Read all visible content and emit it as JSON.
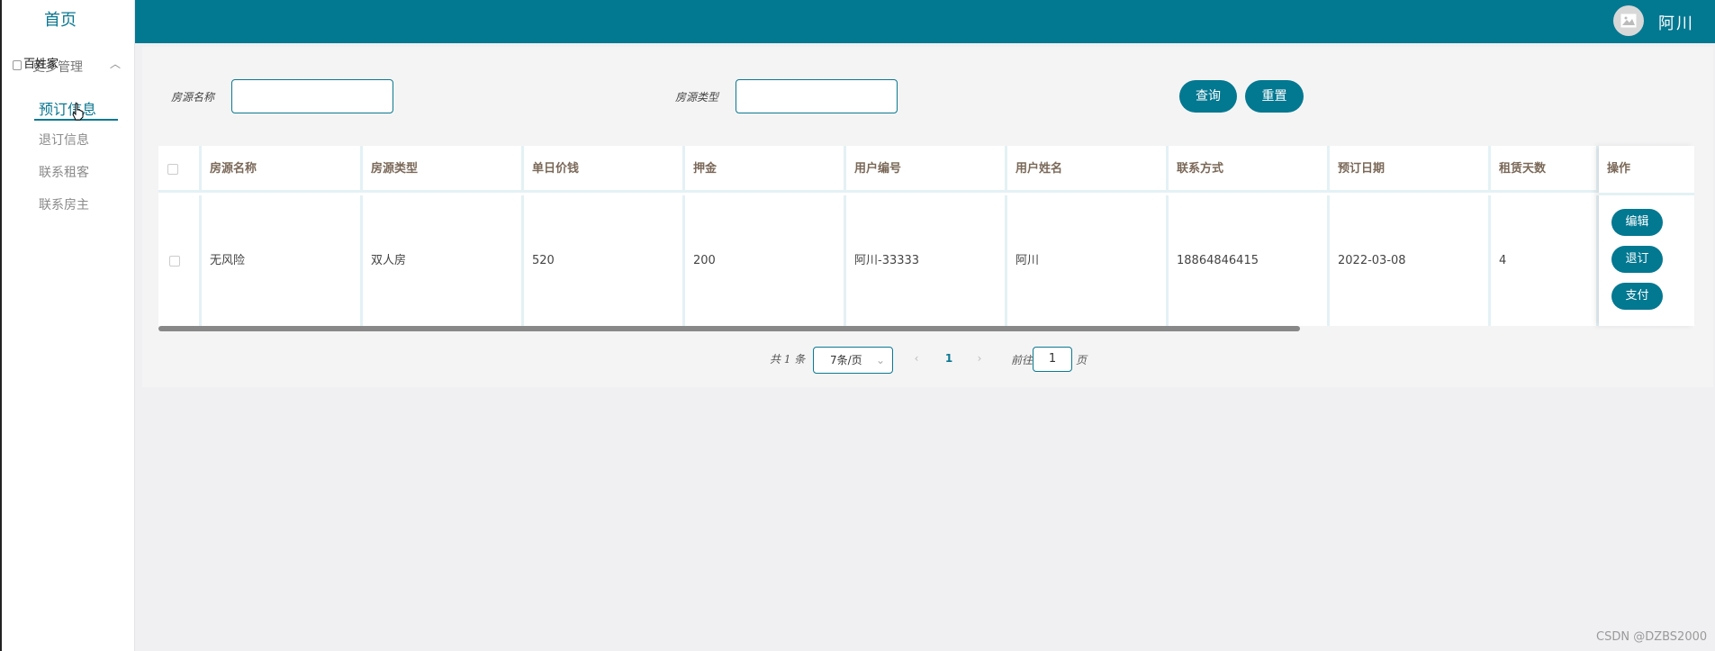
{
  "sidebar": {
    "home": "首页",
    "group_label": "更多管理",
    "overlay_text": "百姓家",
    "items": [
      {
        "label": "预订信息",
        "active": true
      },
      {
        "label": "退订信息",
        "active": false
      },
      {
        "label": "联系租客",
        "active": false
      },
      {
        "label": "联系房主",
        "active": false
      }
    ]
  },
  "header": {
    "username": "阿川"
  },
  "search": {
    "name_label": "房源名称",
    "type_label": "房源类型",
    "query_button": "查询",
    "reset_button": "重置"
  },
  "table": {
    "columns": [
      "房源名称",
      "房源类型",
      "单日价钱",
      "押金",
      "用户编号",
      "用户姓名",
      "联系方式",
      "预订日期",
      "租赁天数",
      "操作"
    ],
    "rows": [
      {
        "cells": [
          "无风险",
          "双人房",
          "520",
          "200",
          "阿川-33333",
          "阿川",
          "18864846415",
          "2022-03-08",
          "4"
        ],
        "actions": [
          "编辑",
          "退订",
          "支付"
        ]
      }
    ]
  },
  "pagination": {
    "total": "共 1 条",
    "page_size": "7条/页",
    "current_page": "1",
    "goto_label": "前往",
    "goto_value": "1",
    "page_suffix": "页"
  },
  "watermark": "CSDN @DZBS2000",
  "colors": {
    "accent": "#037891",
    "header_text": "#7a6858"
  }
}
